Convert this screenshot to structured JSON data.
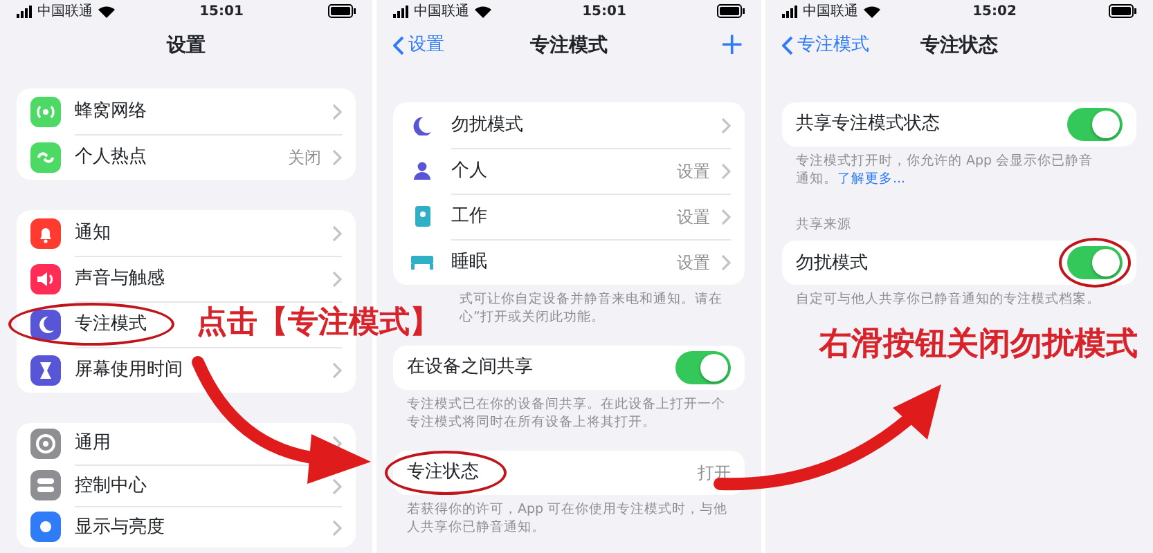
{
  "panels": [
    {
      "status": {
        "carrier": "中国联通",
        "time": "15:01"
      },
      "nav": {
        "title": "设置"
      },
      "groups": [
        {
          "rows": [
            {
              "kind": "link",
              "label": "蜂窝网络"
            },
            {
              "kind": "link",
              "label": "个人热点",
              "value": "关闭"
            }
          ]
        },
        {
          "rows": [
            {
              "kind": "link",
              "label": "通知"
            },
            {
              "kind": "link",
              "label": "声音与触感"
            },
            {
              "kind": "plain",
              "label": "专注模式",
              "circled": true
            },
            {
              "kind": "link",
              "label": "屏幕使用时间"
            }
          ]
        },
        {
          "rows": [
            {
              "kind": "link",
              "label": "通用"
            },
            {
              "kind": "link",
              "label": "控制中心"
            },
            {
              "kind": "link",
              "label": "显示与亮度"
            }
          ]
        }
      ]
    },
    {
      "status": {
        "carrier": "中国联通",
        "time": "15:01"
      },
      "nav": {
        "back": "设置",
        "title": "专注模式",
        "add": "+"
      },
      "groups": [
        {
          "rows": [
            {
              "kind": "link",
              "label": "勿扰模式"
            },
            {
              "kind": "link",
              "label": "个人",
              "value": "设置"
            },
            {
              "kind": "link",
              "label": "工作",
              "value": "设置"
            },
            {
              "kind": "link",
              "label": "睡眠",
              "value": "设置"
            }
          ],
          "footer": {
            "lines": [
              "式可让你自定设备并静音来电和通知。请在",
              "心”打开或关闭此功能。"
            ]
          }
        },
        {
          "rows": [
            {
              "kind": "toggle",
              "label": "在设备之间共享",
              "on": true
            }
          ],
          "footer": {
            "lines": [
              "专注模式已在你的设备间共享。在此设备上打开一个",
              "专注模式将同时在所有设备上将其打开。"
            ]
          }
        },
        {
          "rows": [
            {
              "kind": "value",
              "label": "专注状态",
              "value": "打开",
              "circled": true
            }
          ],
          "footer": {
            "lines": [
              "若获得你的许可，App 可在你使用专注模式时，与他",
              "人共享你已静音通知。"
            ]
          }
        }
      ]
    },
    {
      "status": {
        "carrier": "中国联通",
        "time": "15:02"
      },
      "nav": {
        "back": "专注模式",
        "title": "专注状态"
      },
      "groups": [
        {
          "rows": [
            {
              "kind": "toggle",
              "label": "共享专注模式状态",
              "on": true
            }
          ],
          "footer": {
            "lines": [
              "专注模式打开时，你允许的 App 会显示你已静音",
              "通知。"
            ],
            "link": "了解更多..."
          }
        },
        {
          "header": "共享来源",
          "rows": [
            {
              "kind": "toggle",
              "label": "勿扰模式",
              "on": true,
              "circled": true
            }
          ],
          "footer": {
            "lines": [
              "自定可与他人共享你已静音通知的专注模式档案。"
            ]
          }
        }
      ]
    }
  ],
  "annotations": [
    {
      "text": "点击【专注模式】"
    },
    {
      "text": "右滑按钮关闭勿扰模式"
    }
  ]
}
